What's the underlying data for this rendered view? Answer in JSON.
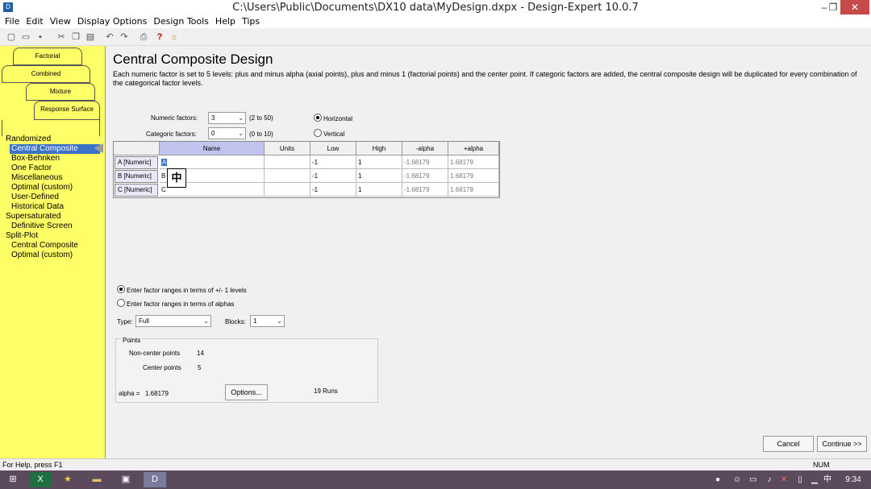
{
  "window": {
    "title": "C:\\Users\\Public\\Documents\\DX10 data\\MyDesign.dxpx - Design-Expert 10.0.7",
    "icon": "app-icon",
    "minimize": "–",
    "restore": "❐",
    "close": "✕"
  },
  "menu": [
    "File",
    "Edit",
    "View",
    "Display Options",
    "Design Tools",
    "Help",
    "Tips"
  ],
  "toolbar_icons": [
    "new-icon",
    "open-icon",
    "save-icon",
    "cut-icon",
    "copy-icon",
    "paste-icon",
    "undo-icon",
    "redo-icon",
    "print-icon",
    "help-icon",
    "tip-icon"
  ],
  "tabs": {
    "factorial": "Factorial",
    "combined": "Combined",
    "mixture": "Mixture",
    "response_surface": "Response Surface"
  },
  "tree": [
    {
      "label": "Randomized",
      "level": 0
    },
    {
      "label": "Central Composite",
      "level": 1,
      "selected": true
    },
    {
      "label": "Box-Behnken",
      "level": 1
    },
    {
      "label": "One Factor",
      "level": 1
    },
    {
      "label": "Miscellaneous",
      "level": 1
    },
    {
      "label": "Optimal (custom)",
      "level": 1
    },
    {
      "label": "User-Defined",
      "level": 1
    },
    {
      "label": "Historical Data",
      "level": 1
    },
    {
      "label": "Supersaturated",
      "level": 0
    },
    {
      "label": "Definitive Screen",
      "level": 1
    },
    {
      "label": "Split-Plot",
      "level": 0
    },
    {
      "label": "Central Composite",
      "level": 1
    },
    {
      "label": "Optimal (custom)",
      "level": 1
    }
  ],
  "main": {
    "title": "Central Composite Design",
    "description": "Each numeric factor is set to 5 levels: plus and minus alpha (axial points), plus and minus 1 (factorial points) and the center point. If categoric factors are added, the central composite design will be duplicated for every combination of the categorical factor levels.",
    "numeric_factors": {
      "label": "Numeric factors:",
      "value": "3",
      "range": "(2 to 50)"
    },
    "categoric_factors": {
      "label": "Categoric factors:",
      "value": "0",
      "range": "(0 to 10)"
    },
    "orientation": {
      "horizontal": "Horizontal",
      "vertical": "Vertical",
      "selected": "horizontal"
    },
    "grid": {
      "headers": [
        "Name",
        "Units",
        "Low",
        "High",
        "-alpha",
        "+alpha"
      ],
      "rows": [
        {
          "factor": "A [Numeric]",
          "name": "A",
          "units": "",
          "low": "-1",
          "high": "1",
          "minus_alpha": "-1.68179",
          "plus_alpha": "1.68179"
        },
        {
          "factor": "B [Numeric]",
          "name": "B",
          "units": "",
          "low": "-1",
          "high": "1",
          "minus_alpha": "-1.68179",
          "plus_alpha": "1.68179"
        },
        {
          "factor": "C [Numeric]",
          "name": "C",
          "units": "",
          "low": "-1",
          "high": "1",
          "minus_alpha": "-1.68179",
          "plus_alpha": "1.68179"
        }
      ]
    },
    "ime_indicator": "中",
    "range_mode": {
      "levels": "Enter factor ranges in terms of +/- 1 levels",
      "alphas": "Enter factor ranges in terms of alphas",
      "selected": "levels"
    },
    "type": {
      "label": "Type:",
      "value": "Full"
    },
    "blocks": {
      "label": "Blocks:",
      "value": "1"
    },
    "points": {
      "title": "Points",
      "non_center_label": "Non-center points",
      "non_center_value": "14",
      "center_label": "Center points",
      "center_value": "5",
      "alpha_label": "alpha =",
      "alpha_value": "1.68179",
      "options_button": "Options...",
      "runs": "19 Runs"
    },
    "cancel_button": "Cancel",
    "continue_button": "Continue >>"
  },
  "status": {
    "help": "For Help, press F1",
    "num": "NUM"
  },
  "taskbar": {
    "clock": "9:34",
    "ime": "中"
  }
}
